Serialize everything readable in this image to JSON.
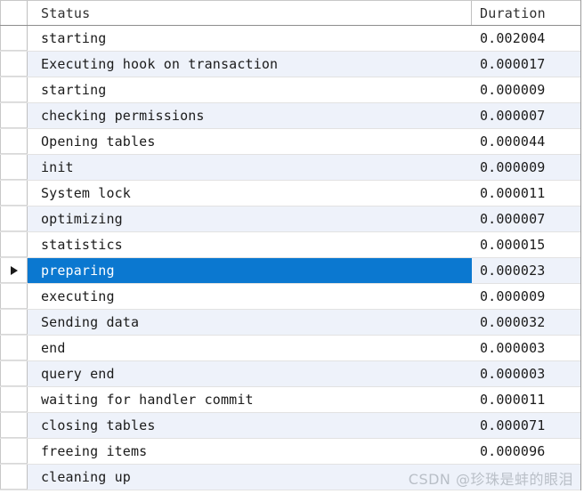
{
  "table": {
    "columns": [
      {
        "key": "status",
        "label": "Status"
      },
      {
        "key": "duration",
        "label": "Duration"
      }
    ],
    "selected_row_index": 9,
    "row_marker_glyph": "▶",
    "colors": {
      "selection": "#0b78d0",
      "stripe": "#eef2fa",
      "base": "#ffffff",
      "grid_line": "#c0c0c0",
      "header_text": "#303030",
      "cell_text": "#1b1b1b",
      "watermark": "#b9bfc7"
    },
    "rows": [
      {
        "status": "starting",
        "duration": "0.002004"
      },
      {
        "status": "Executing hook on transaction",
        "duration": "0.000017"
      },
      {
        "status": "starting",
        "duration": "0.000009"
      },
      {
        "status": "checking permissions",
        "duration": "0.000007"
      },
      {
        "status": "Opening tables",
        "duration": "0.000044"
      },
      {
        "status": "init",
        "duration": "0.000009"
      },
      {
        "status": "System lock",
        "duration": "0.000011"
      },
      {
        "status": "optimizing",
        "duration": "0.000007"
      },
      {
        "status": "statistics",
        "duration": "0.000015"
      },
      {
        "status": "preparing",
        "duration": "0.000023"
      },
      {
        "status": "executing",
        "duration": "0.000009"
      },
      {
        "status": "Sending data",
        "duration": "0.000032"
      },
      {
        "status": "end",
        "duration": "0.000003"
      },
      {
        "status": "query end",
        "duration": "0.000003"
      },
      {
        "status": "waiting for handler commit",
        "duration": "0.000011"
      },
      {
        "status": "closing tables",
        "duration": "0.000071"
      },
      {
        "status": "freeing items",
        "duration": "0.000096"
      },
      {
        "status": "cleaning up",
        "duration": ""
      }
    ]
  },
  "watermark": {
    "text": "CSDN @珍珠是蚌的眼泪"
  }
}
